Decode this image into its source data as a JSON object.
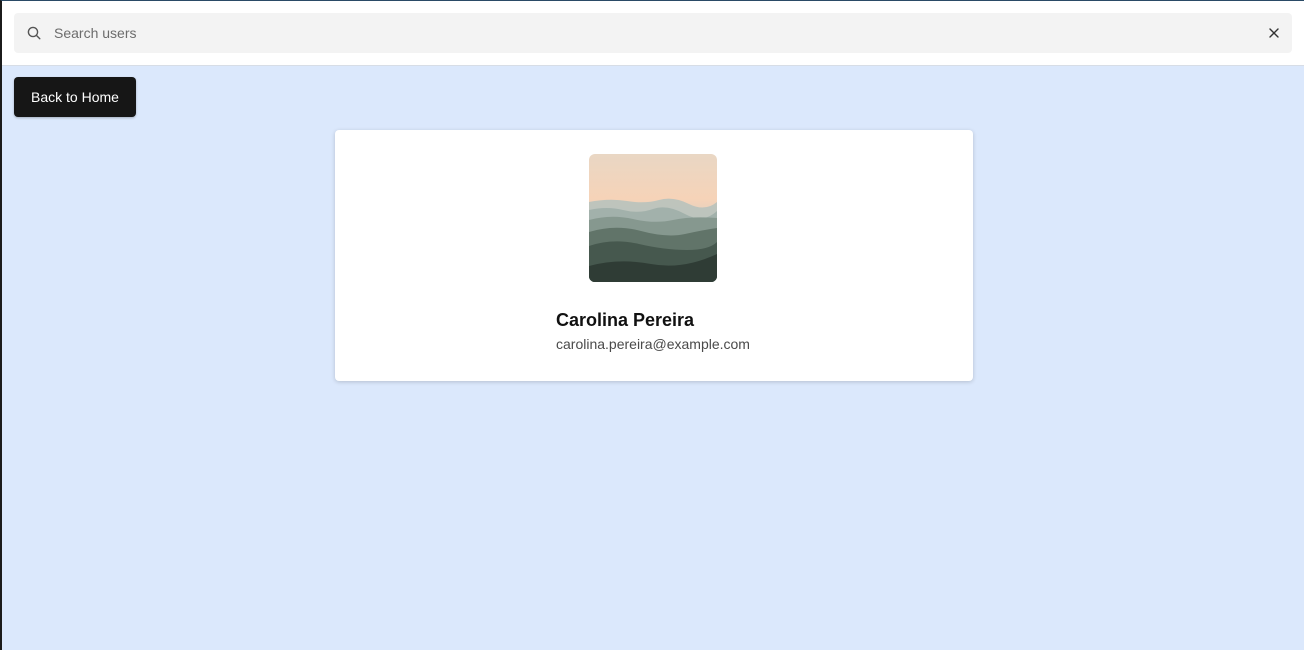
{
  "search": {
    "placeholder": "Search users",
    "value": "",
    "icon": "search-icon",
    "clear_icon": "close-icon"
  },
  "nav": {
    "back_label": "Back to Home"
  },
  "profile": {
    "name": "Carolina Pereira",
    "email": "carolina.pereira@example.com",
    "avatar": "mountain-landscape-photo"
  },
  "colors": {
    "page_background": "#dbe8fc",
    "button_background": "#161616",
    "card_background": "#ffffff",
    "search_background": "#f3f3f3"
  }
}
